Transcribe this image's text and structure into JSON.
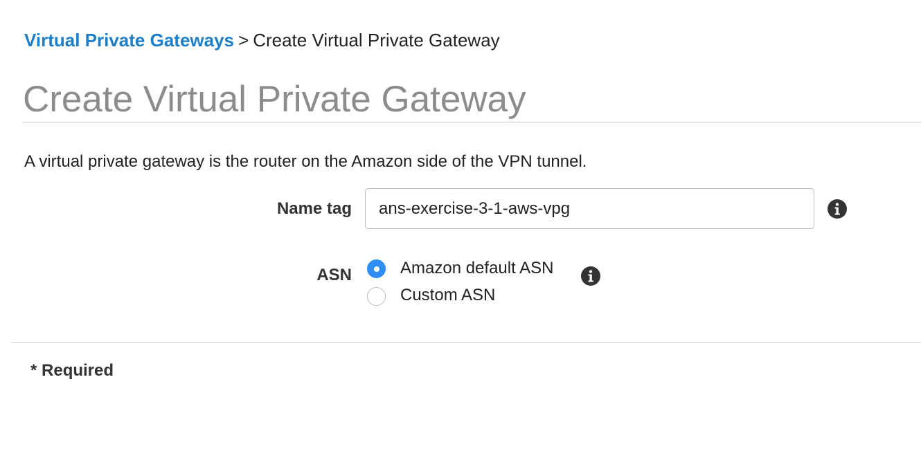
{
  "breadcrumb": {
    "parent": "Virtual Private Gateways",
    "separator": ">",
    "current": "Create Virtual Private Gateway"
  },
  "page_title": "Create Virtual Private Gateway",
  "description": "A virtual private gateway is the router on the Amazon side of the VPN tunnel.",
  "form": {
    "name_tag": {
      "label": "Name tag",
      "value": "ans-exercise-3-1-aws-vpg",
      "info_icon": "info-icon"
    },
    "asn": {
      "label": "ASN",
      "options": [
        {
          "label": "Amazon default ASN",
          "selected": true
        },
        {
          "label": "Custom ASN",
          "selected": false
        }
      ],
      "info_icon": "info-icon"
    }
  },
  "footer": {
    "required_note": "* Required"
  },
  "colors": {
    "link": "#1d7fc9",
    "title": "#8c8c8c",
    "radio_selected": "#2f8ef5",
    "info_icon": "#333333"
  }
}
